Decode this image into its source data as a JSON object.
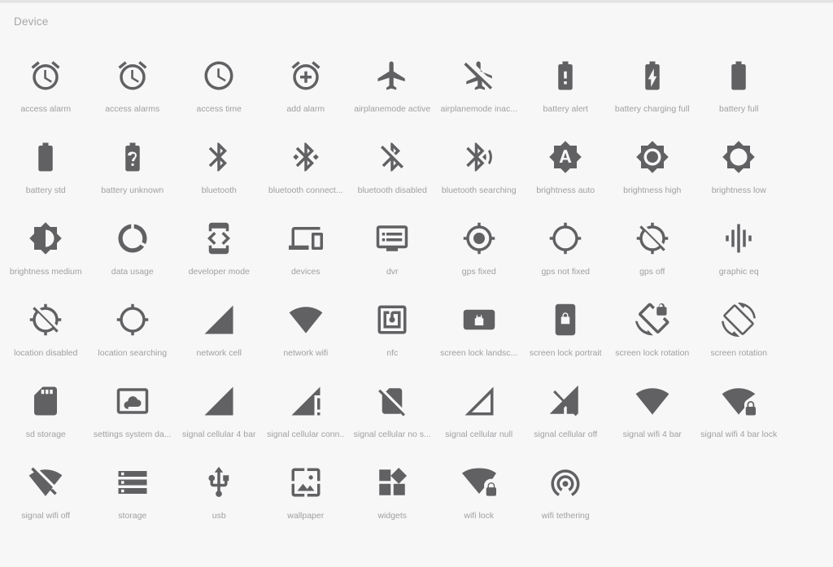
{
  "page": {
    "category_title": "Device",
    "background_color": "#f7f7f8",
    "icon_color": "#616163",
    "label_color": "#a0a0a2",
    "title_color": "#a7a7a9",
    "columns": 9,
    "rows": 6
  },
  "icons": [
    {
      "label": "access alarm",
      "icon": "access-alarm-icon"
    },
    {
      "label": "access alarms",
      "icon": "access-alarms-icon"
    },
    {
      "label": "access time",
      "icon": "access-time-icon"
    },
    {
      "label": "add alarm",
      "icon": "add-alarm-icon"
    },
    {
      "label": "airplanemode active",
      "icon": "airplanemode-active-icon"
    },
    {
      "label": "airplanemode inac...",
      "icon": "airplanemode-inactive-icon"
    },
    {
      "label": "battery alert",
      "icon": "battery-alert-icon"
    },
    {
      "label": "battery charging full",
      "icon": "battery-charging-full-icon"
    },
    {
      "label": "battery full",
      "icon": "battery-full-icon"
    },
    {
      "label": "battery std",
      "icon": "battery-std-icon"
    },
    {
      "label": "battery unknown",
      "icon": "battery-unknown-icon"
    },
    {
      "label": "bluetooth",
      "icon": "bluetooth-icon"
    },
    {
      "label": "bluetooth connect...",
      "icon": "bluetooth-connected-icon"
    },
    {
      "label": "bluetooth disabled",
      "icon": "bluetooth-disabled-icon"
    },
    {
      "label": "bluetooth searching",
      "icon": "bluetooth-searching-icon"
    },
    {
      "label": "brightness auto",
      "icon": "brightness-auto-icon"
    },
    {
      "label": "brightness high",
      "icon": "brightness-high-icon"
    },
    {
      "label": "brightness low",
      "icon": "brightness-low-icon"
    },
    {
      "label": "brightness medium",
      "icon": "brightness-medium-icon"
    },
    {
      "label": "data usage",
      "icon": "data-usage-icon"
    },
    {
      "label": "developer mode",
      "icon": "developer-mode-icon"
    },
    {
      "label": "devices",
      "icon": "devices-icon"
    },
    {
      "label": "dvr",
      "icon": "dvr-icon"
    },
    {
      "label": "gps fixed",
      "icon": "gps-fixed-icon"
    },
    {
      "label": "gps not fixed",
      "icon": "gps-not-fixed-icon"
    },
    {
      "label": "gps off",
      "icon": "gps-off-icon"
    },
    {
      "label": "graphic eq",
      "icon": "graphic-eq-icon"
    },
    {
      "label": "location disabled",
      "icon": "location-disabled-icon"
    },
    {
      "label": "location searching",
      "icon": "location-searching-icon"
    },
    {
      "label": "network cell",
      "icon": "network-cell-icon"
    },
    {
      "label": "network wifi",
      "icon": "network-wifi-icon"
    },
    {
      "label": "nfc",
      "icon": "nfc-icon"
    },
    {
      "label": "screen lock landsc...",
      "icon": "screen-lock-landscape-icon"
    },
    {
      "label": "screen lock portrait",
      "icon": "screen-lock-portrait-icon"
    },
    {
      "label": "screen lock rotation",
      "icon": "screen-lock-rotation-icon"
    },
    {
      "label": "screen rotation",
      "icon": "screen-rotation-icon"
    },
    {
      "label": "sd storage",
      "icon": "sd-storage-icon"
    },
    {
      "label": "settings system da...",
      "icon": "settings-system-daydream-icon"
    },
    {
      "label": "signal cellular 4 bar",
      "icon": "signal-cellular-4-bar-icon"
    },
    {
      "label": "signal cellular conn..",
      "icon": "signal-cellular-connected-no-internet-icon"
    },
    {
      "label": "signal cellular no s...",
      "icon": "signal-cellular-no-sim-icon"
    },
    {
      "label": "signal cellular null",
      "icon": "signal-cellular-null-icon"
    },
    {
      "label": "signal cellular off",
      "icon": "signal-cellular-off-icon"
    },
    {
      "label": "signal wifi 4 bar",
      "icon": "signal-wifi-4-bar-icon"
    },
    {
      "label": "signal wifi 4 bar lock",
      "icon": "signal-wifi-4-bar-lock-icon"
    },
    {
      "label": "signal wifi off",
      "icon": "signal-wifi-off-icon"
    },
    {
      "label": "storage",
      "icon": "storage-icon"
    },
    {
      "label": "usb",
      "icon": "usb-icon"
    },
    {
      "label": "wallpaper",
      "icon": "wallpaper-icon"
    },
    {
      "label": "widgets",
      "icon": "widgets-icon"
    },
    {
      "label": "wifi lock",
      "icon": "wifi-lock-icon"
    },
    {
      "label": "wifi tethering",
      "icon": "wifi-tethering-icon"
    }
  ]
}
